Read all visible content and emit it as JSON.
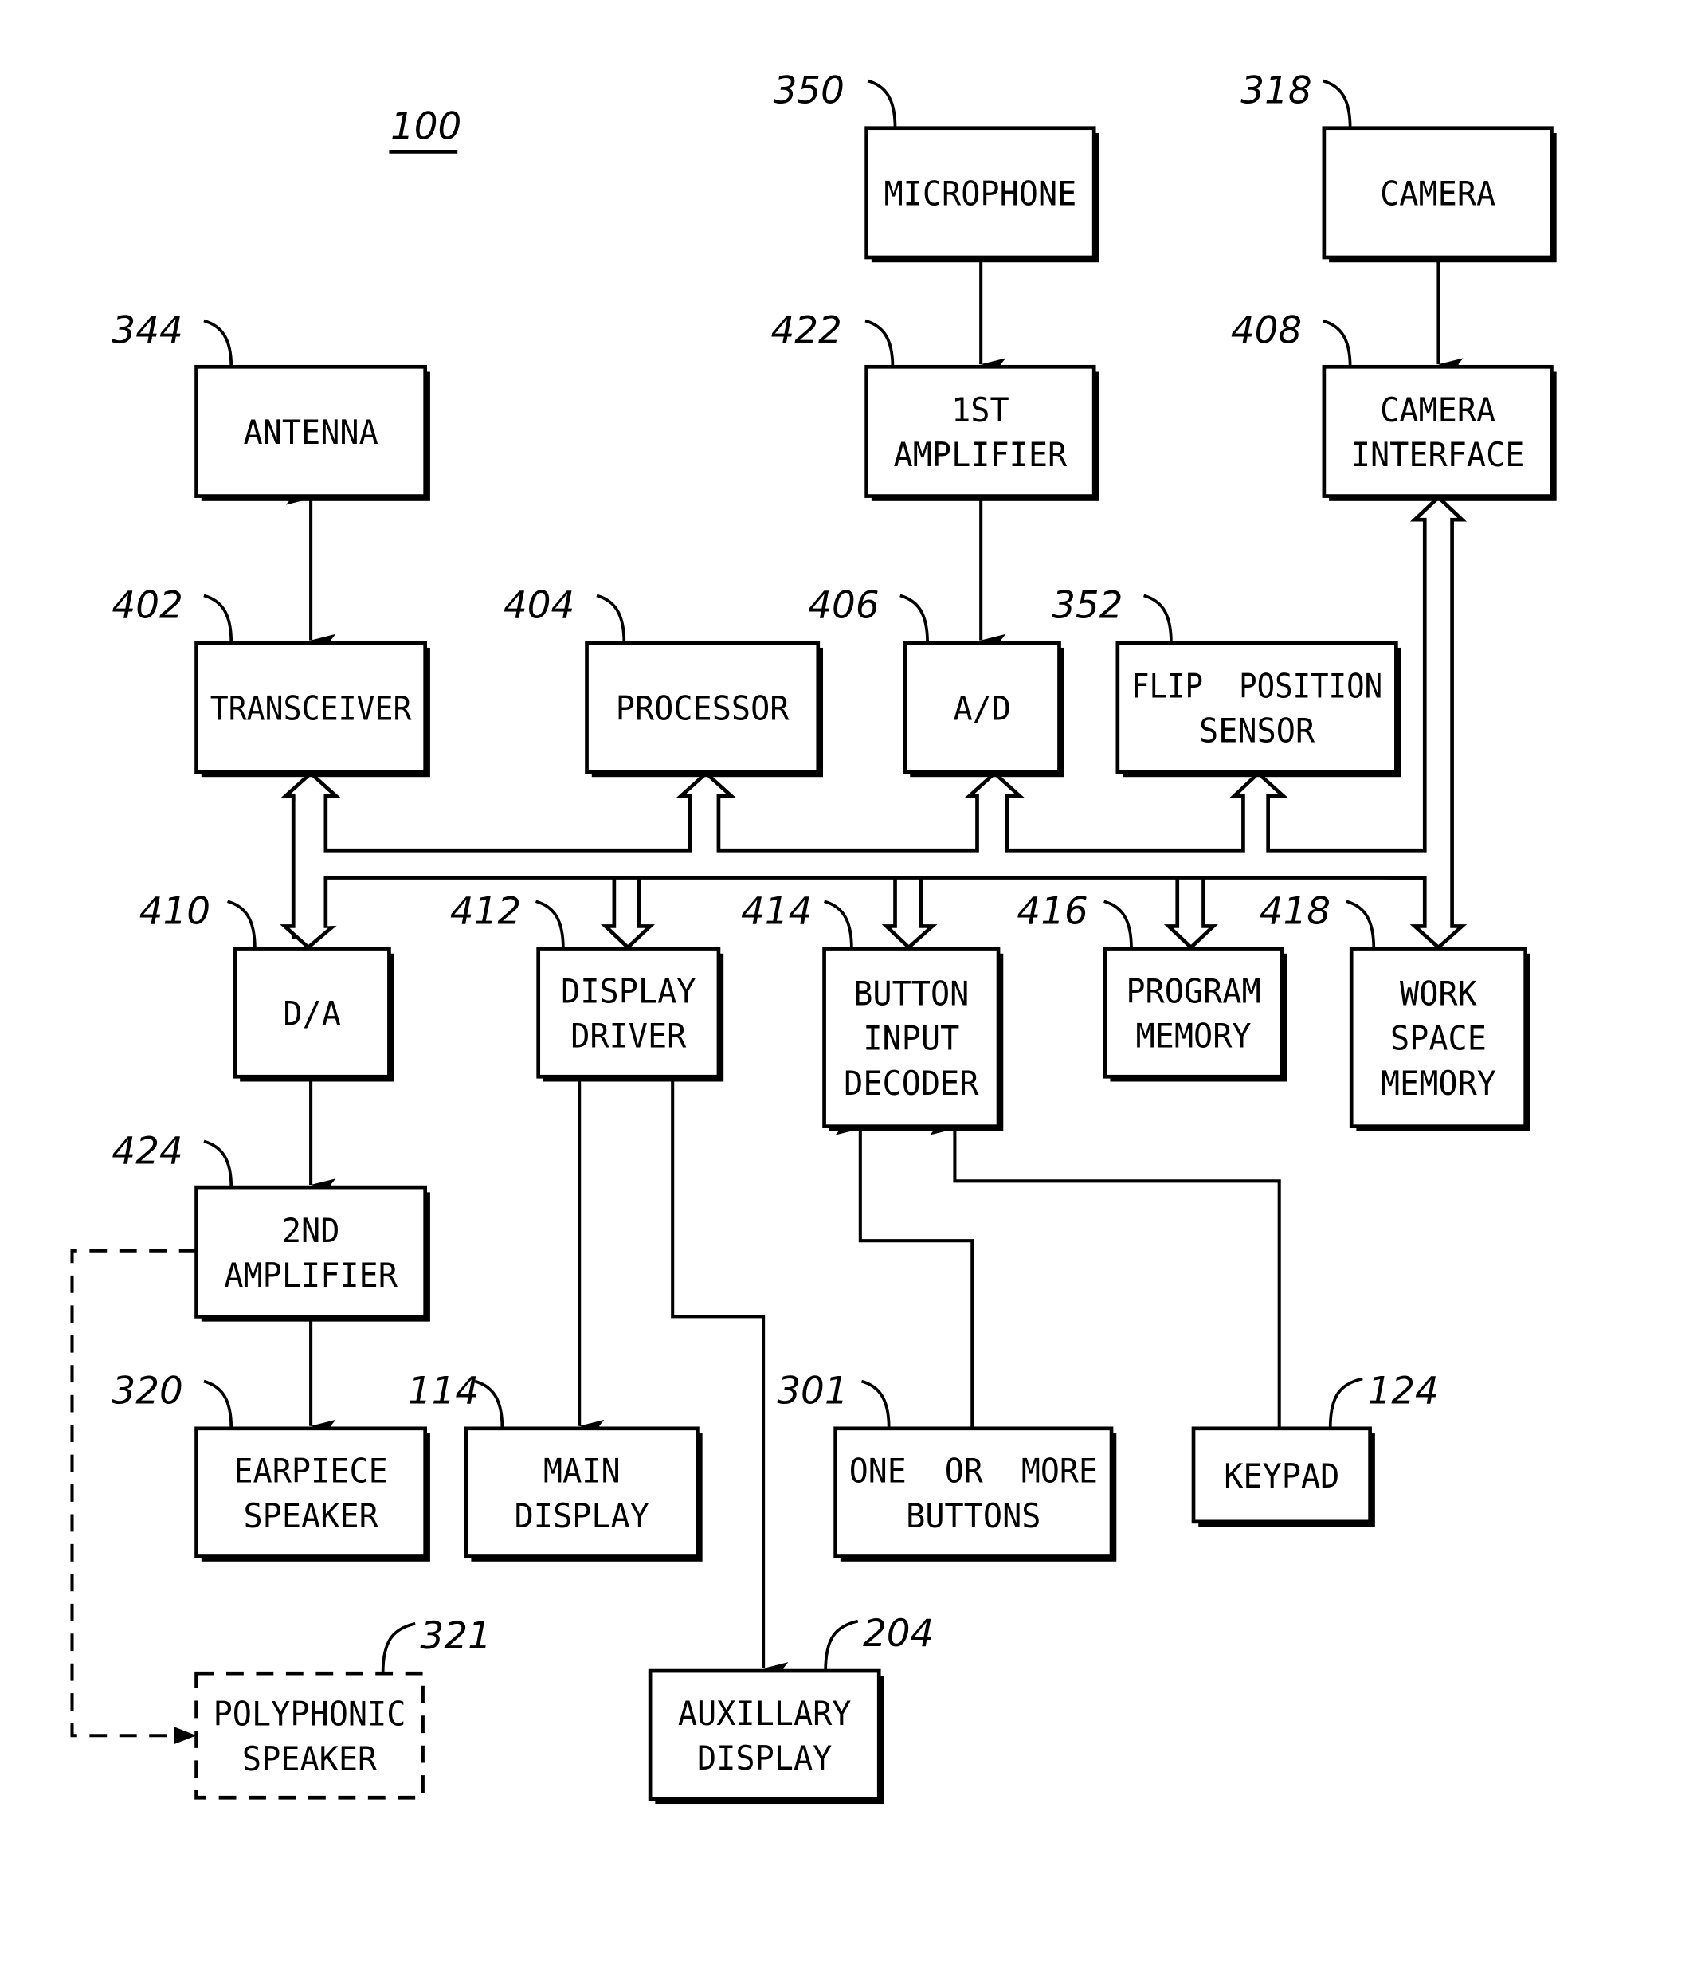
{
  "figure": {
    "reference": "100",
    "accent_color": "#000000",
    "background_color": "#ffffff"
  },
  "blocks": {
    "microphone": {
      "ref": "350",
      "lines": [
        "MICROPHONE"
      ]
    },
    "camera": {
      "ref": "318",
      "lines": [
        "CAMERA"
      ]
    },
    "antenna": {
      "ref": "344",
      "lines": [
        "ANTENNA"
      ]
    },
    "amp1": {
      "ref": "422",
      "lines": [
        "1ST",
        "AMPLIFIER"
      ]
    },
    "camera_interface": {
      "ref": "408",
      "lines": [
        "CAMERA",
        "INTERFACE"
      ]
    },
    "transceiver": {
      "ref": "402",
      "lines": [
        "TRANSCEIVER"
      ]
    },
    "processor": {
      "ref": "404",
      "lines": [
        "PROCESSOR"
      ]
    },
    "ad": {
      "ref": "406",
      "lines": [
        "A/D"
      ]
    },
    "flip_sensor": {
      "ref": "352",
      "lines": [
        "FLIP  POSITION",
        "SENSOR"
      ]
    },
    "da": {
      "ref": "410",
      "lines": [
        "D/A"
      ]
    },
    "display_driver": {
      "ref": "412",
      "lines": [
        "DISPLAY",
        "DRIVER"
      ]
    },
    "button_decoder": {
      "ref": "414",
      "lines": [
        "BUTTON",
        "INPUT",
        "DECODER"
      ]
    },
    "program_memory": {
      "ref": "416",
      "lines": [
        "PROGRAM",
        "MEMORY"
      ]
    },
    "workspace_memory": {
      "ref": "418",
      "lines": [
        "WORK",
        "SPACE",
        "MEMORY"
      ]
    },
    "amp2": {
      "ref": "424",
      "lines": [
        "2ND",
        "AMPLIFIER"
      ]
    },
    "earpiece": {
      "ref": "320",
      "lines": [
        "EARPIECE",
        "SPEAKER"
      ]
    },
    "main_display": {
      "ref": "114",
      "lines": [
        "MAIN",
        "DISPLAY"
      ]
    },
    "buttons": {
      "ref": "301",
      "lines": [
        "ONE  OR  MORE",
        "BUTTONS"
      ]
    },
    "keypad": {
      "ref": "124",
      "lines": [
        "KEYPAD"
      ]
    },
    "polyphonic": {
      "ref": "321",
      "lines": [
        "POLYPHONIC",
        "SPEAKER"
      ],
      "optional": true
    },
    "aux_display": {
      "ref": "204",
      "lines": [
        "AUXILLARY",
        "DISPLAY"
      ]
    }
  },
  "connections": [
    {
      "from": "microphone",
      "to": "amp1",
      "type": "arrow"
    },
    {
      "from": "camera",
      "to": "camera_interface",
      "type": "arrow"
    },
    {
      "from": "antenna",
      "to": "transceiver",
      "type": "bidirectional"
    },
    {
      "from": "amp1",
      "to": "ad",
      "type": "arrow"
    },
    {
      "from": "transceiver",
      "to": "da",
      "type": "bus-bidirectional"
    },
    {
      "from": "bus",
      "to": [
        "transceiver",
        "processor",
        "ad",
        "flip_sensor",
        "camera_interface"
      ],
      "type": "bus-upper"
    },
    {
      "from": "bus",
      "to": [
        "da",
        "display_driver",
        "button_decoder",
        "program_memory",
        "workspace_memory"
      ],
      "type": "bus-lower"
    },
    {
      "from": "camera_interface",
      "to": "workspace_memory",
      "type": "bus-bidirectional"
    },
    {
      "from": "da",
      "to": "amp2",
      "type": "arrow"
    },
    {
      "from": "amp2",
      "to": "earpiece",
      "type": "arrow"
    },
    {
      "from": "amp2",
      "to": "polyphonic",
      "type": "dashed-arrow"
    },
    {
      "from": "display_driver",
      "to": "main_display",
      "type": "arrow"
    },
    {
      "from": "display_driver",
      "to": "aux_display",
      "type": "arrow"
    },
    {
      "from": "buttons",
      "to": "button_decoder",
      "type": "arrow"
    },
    {
      "from": "keypad",
      "to": "button_decoder",
      "type": "arrow"
    }
  ]
}
